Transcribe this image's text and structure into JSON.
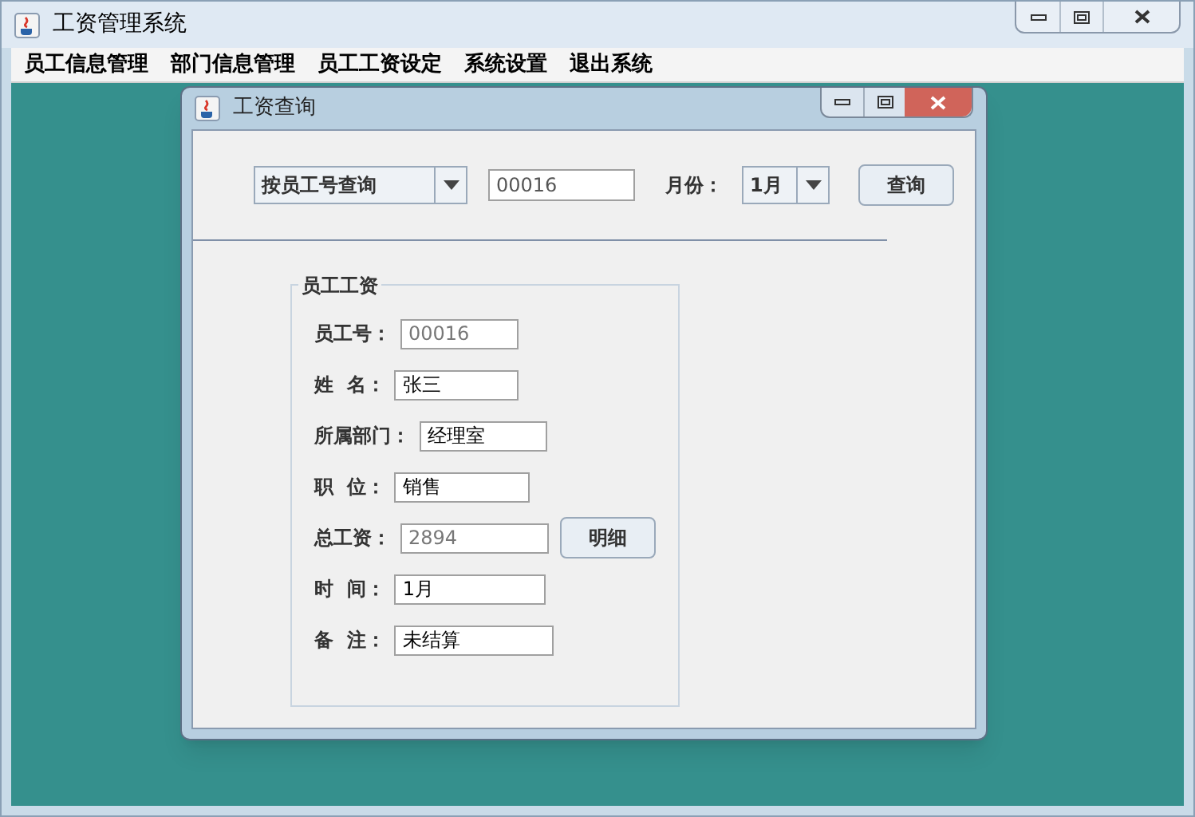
{
  "window": {
    "title": "工资管理系统"
  },
  "menu": [
    {
      "label": "员工信息管理"
    },
    {
      "label": "部门信息管理"
    },
    {
      "label": "员工工资设定"
    },
    {
      "label": "系统设置"
    },
    {
      "label": "退出系统"
    }
  ],
  "dialog": {
    "title": "工资查询",
    "query": {
      "mode": "按员工号查询",
      "id_value": "00016",
      "month_label": "月份：",
      "month": "1月",
      "button": "查询"
    },
    "group": {
      "title": "员工工资",
      "fields": [
        {
          "label": "员工号：",
          "value": "00016",
          "disabled": true
        },
        {
          "label": "姓  名：",
          "value": "张三",
          "disabled": false
        },
        {
          "label": "所属部门：",
          "value": "经理室",
          "disabled": false
        },
        {
          "label": "职  位：",
          "value": "销售",
          "disabled": false
        },
        {
          "label": "总工资：",
          "value": "2894",
          "disabled": true
        },
        {
          "label": "时  间：",
          "value": "1月",
          "disabled": false
        },
        {
          "label": "备  注：",
          "value": "未结算",
          "disabled": false
        }
      ],
      "detail_button": "明细"
    }
  }
}
